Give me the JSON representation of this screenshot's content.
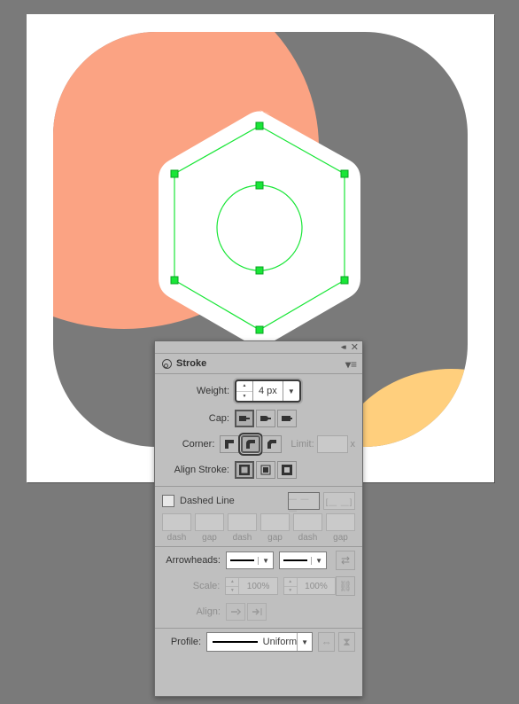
{
  "canvas": {
    "colors": {
      "bg": "#7a7a7a",
      "artboard": "#ffffff",
      "shape_gray": "#7a7a7a",
      "accent_peach": "#fba383",
      "accent_yellow": "#ffcf7d",
      "hex_fill": "#ffffff",
      "selection": "#19e637"
    }
  },
  "panel": {
    "title": "Stroke",
    "weight_label": "Weight:",
    "weight_value": "4 px",
    "cap_label": "Cap:",
    "corner_label": "Corner:",
    "limit_label": "Limit:",
    "limit_value": "",
    "limit_suffix": "x",
    "align_label": "Align Stroke:",
    "dashed_label": "Dashed Line",
    "dash_gap_labels": [
      "dash",
      "gap",
      "dash",
      "gap",
      "dash",
      "gap"
    ],
    "arrowheads_label": "Arrowheads:",
    "scale_label": "Scale:",
    "scale_start": "100%",
    "scale_end": "100%",
    "align_arrow_label": "Align:",
    "profile_label": "Profile:",
    "profile_value": "Uniform"
  }
}
